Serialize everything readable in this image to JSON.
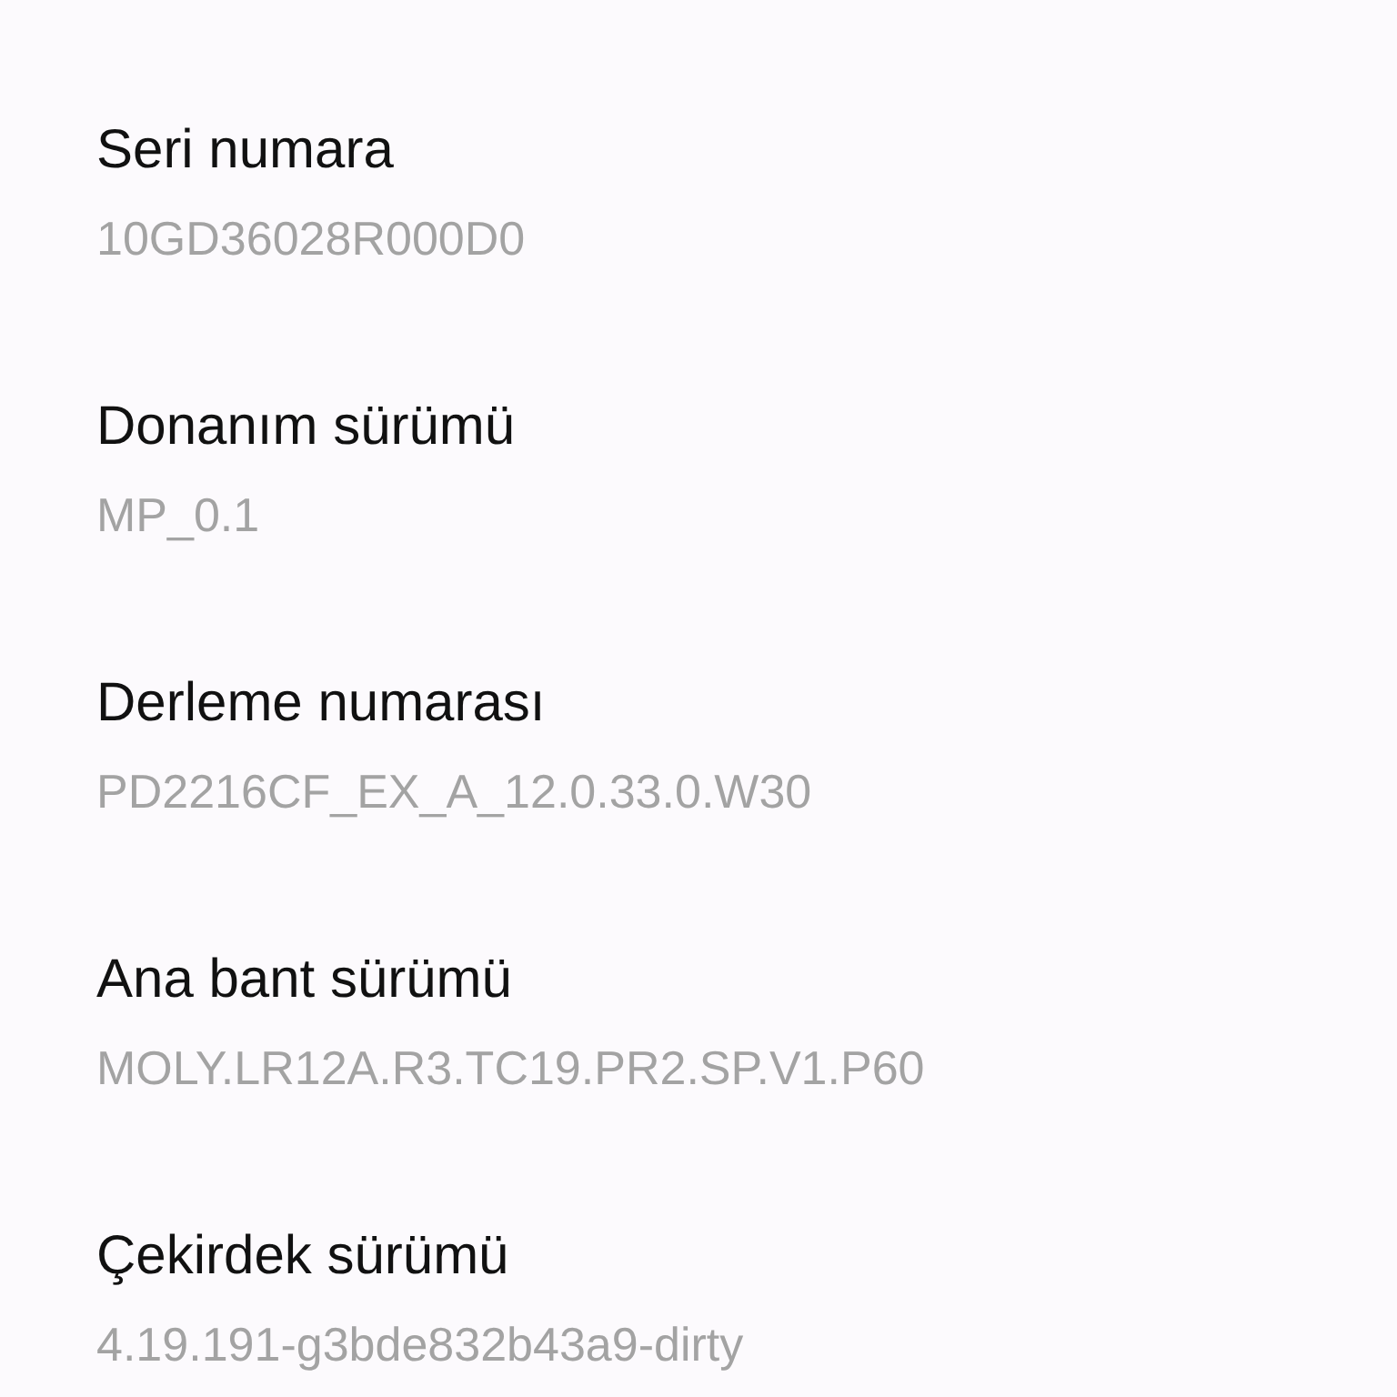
{
  "items": [
    {
      "title": "Seri numara",
      "value": "10GD36028R000D0"
    },
    {
      "title": "Donanım sürümü",
      "value": "MP_0.1"
    },
    {
      "title": "Derleme numarası",
      "value": "PD2216CF_EX_A_12.0.33.0.W30"
    },
    {
      "title": "Ana bant sürümü",
      "value": "MOLY.LR12A.R3.TC19.PR2.SP.V1.P60"
    },
    {
      "title": "Çekirdek sürümü",
      "value": "4.19.191-g3bde832b43a9-dirty"
    }
  ]
}
